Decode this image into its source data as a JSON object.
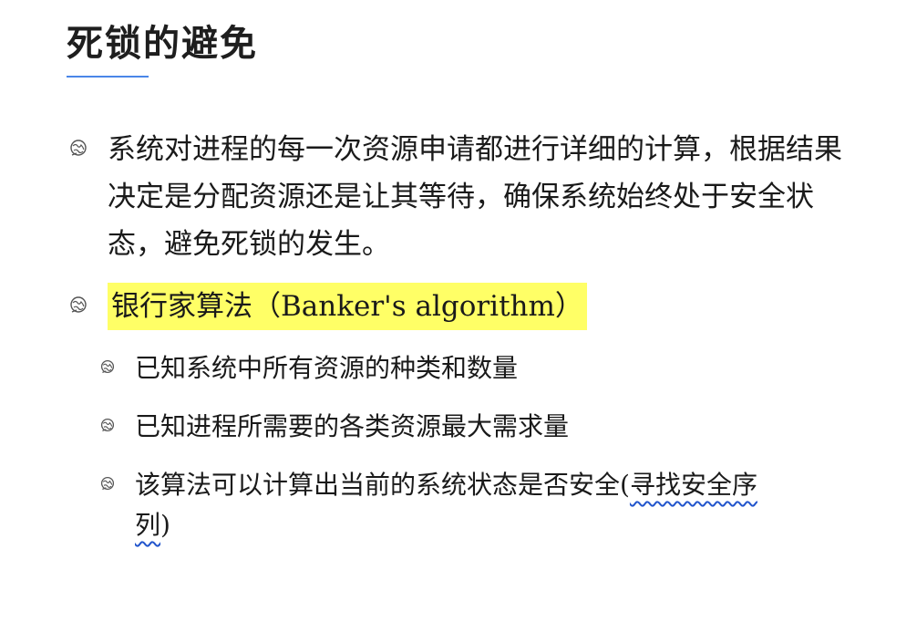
{
  "title": "死锁的避免",
  "colors": {
    "title_underline": "#4a86e8",
    "highlight_bg": "#ffff66",
    "highlight_text": "#a52a00",
    "squiggle": "#2255cc"
  },
  "bullets": {
    "intro": "系统对进程的每一次资源申请都进行详细的计算，根据结果决定是分配资源还是让其等待，确保系统始终处于安全状态，避免死锁的发生。",
    "bankers": "银行家算法（Banker's algorithm）",
    "sub1": "已知系统中所有资源的种类和数量",
    "sub2": "已知进程所需要的各类资源最大需求量",
    "sub3_main": "该算法可以计算出当前的系统状态是否安全(",
    "sub3_squiggle_a": "寻找安全序",
    "sub3_squiggle_b": "列",
    "sub3_end": ")"
  },
  "icons": {
    "bullet_icon": "globe-bullet-icon"
  }
}
